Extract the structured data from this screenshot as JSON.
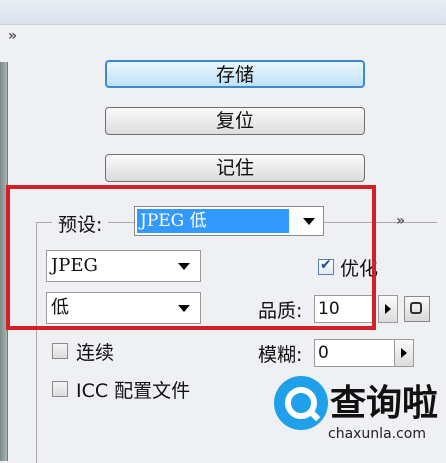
{
  "buttons": {
    "save": "存储",
    "reset": "复位",
    "remember": "记住"
  },
  "preset": {
    "label": "预设:",
    "value": "JPEG 低"
  },
  "format": {
    "value": "JPEG"
  },
  "optimize": {
    "label": "优化",
    "checked": true
  },
  "compression": {
    "value": "低"
  },
  "quality": {
    "label": "品质:",
    "value": "10"
  },
  "progressive": {
    "label": "连续",
    "checked": false
  },
  "blur": {
    "label": "模糊:",
    "value": "0"
  },
  "icc": {
    "label": "ICC 配置文件",
    "checked": false
  },
  "watermark": {
    "brand": "查询啦",
    "domain": "chaxunla.com"
  },
  "colors": {
    "highlight": "#d22026",
    "selection": "#3399ff",
    "primary_button_border": "#3c8bd0",
    "logo": "#1fa0e8"
  }
}
